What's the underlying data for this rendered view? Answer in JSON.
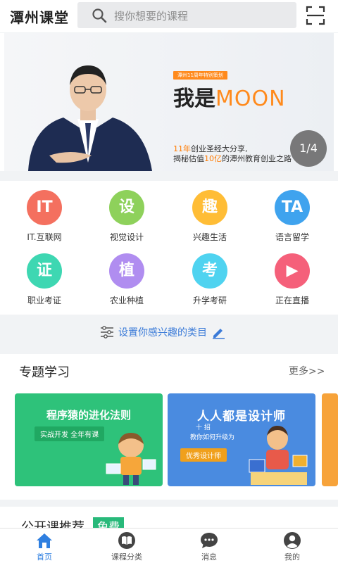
{
  "header": {
    "title": "潭州课堂",
    "search_placeholder": "搜你想要的课程"
  },
  "banner": {
    "tag": "潭州11周年特别策划",
    "title_prefix": "我是",
    "title_name": "MOON",
    "sub_line1_highlight": "11年",
    "sub_line1_rest": "创业圣经大分享,",
    "sub_line2_a": "揭秘估值",
    "sub_line2_highlight": "10亿",
    "sub_line2_b": "的潭州教育创业之路",
    "pager": "1/4"
  },
  "categories": [
    {
      "glyph": "IT",
      "label": "IT.互联网",
      "color": "#f4705f"
    },
    {
      "glyph": "设",
      "label": "视觉设计",
      "color": "#8ed15b"
    },
    {
      "glyph": "趣",
      "label": "兴趣生活",
      "color": "#ffbd36"
    },
    {
      "glyph": "TA",
      "label": "语言留学",
      "color": "#3fa3ee"
    },
    {
      "glyph": "证",
      "label": "职业考证",
      "color": "#3ed7b2"
    },
    {
      "glyph": "植",
      "label": "农业种植",
      "color": "#b08df0"
    },
    {
      "glyph": "考",
      "label": "升学考研",
      "color": "#4fd3f0"
    },
    {
      "glyph": "▶",
      "label": "正在直播",
      "color": "#f5607a"
    }
  ],
  "interest": {
    "label": "设置你感兴趣的类目"
  },
  "topics": {
    "title": "专题学习",
    "more": "更多>>",
    "card1": {
      "title": "程序猿的进化法则",
      "sub": "实战开发 全年有课"
    },
    "card2": {
      "title": "人人都是设计师",
      "sub1": "十 招",
      "sub2": "教你如何升级为",
      "badge": "优秀设计师"
    }
  },
  "public_class": {
    "title": "公开课推荐",
    "badge": "免费"
  },
  "tabs": [
    {
      "label": "首页",
      "active": true
    },
    {
      "label": "课程分类",
      "active": false
    },
    {
      "label": "消息",
      "active": false
    },
    {
      "label": "我的",
      "active": false
    }
  ],
  "colors": {
    "accent": "#2f7fe0",
    "orange": "#ff8a1c",
    "green": "#2ec27a"
  }
}
